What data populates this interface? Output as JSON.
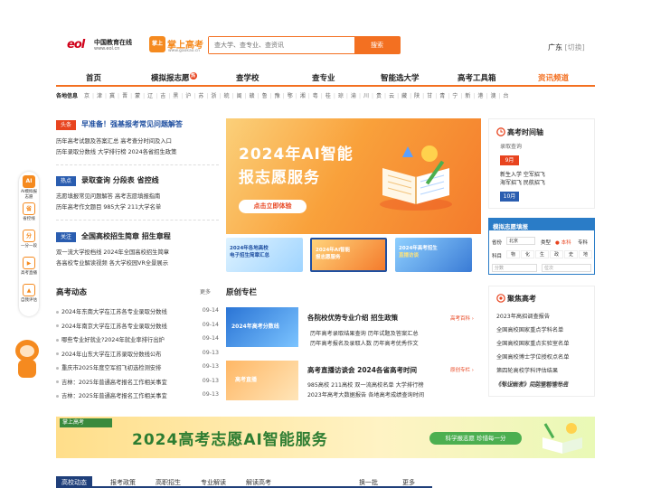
{
  "header": {
    "logo1_mark": "eol",
    "logo1_name": "中国教育在线",
    "logo1_url": "www.eol.cn",
    "logo2_icon": "掌上",
    "logo2_name": "掌上高考",
    "logo2_url": "www.gaokao.cn",
    "search_placeholder": "查大学、查专业、查资讯",
    "search_button": "搜索",
    "location": "广东",
    "switch": "[切换]"
  },
  "nav": {
    "items": [
      "首页",
      "模拟报志愿",
      "查学校",
      "查专业",
      "智能选大学",
      "高考工具箱",
      "资讯频道"
    ],
    "badge": "热"
  },
  "provinces": {
    "label": "各地信息",
    "list": [
      "京",
      "津",
      "冀",
      "晋",
      "蒙",
      "辽",
      "吉",
      "黑",
      "沪",
      "苏",
      "浙",
      "皖",
      "闽",
      "赣",
      "鲁",
      "豫",
      "鄂",
      "湘",
      "粤",
      "桂",
      "琼",
      "渝",
      "川",
      "贵",
      "云",
      "藏",
      "陕",
      "甘",
      "青",
      "宁",
      "新",
      "港",
      "澳",
      "台"
    ]
  },
  "float_bar": [
    {
      "icon": "AI",
      "label": "AI模拟报志愿"
    },
    {
      "icon": "省",
      "label": "省控线"
    },
    {
      "icon": "分",
      "label": "一分一段"
    },
    {
      "icon": "▶",
      "label": "高考直播"
    },
    {
      "icon": "▲",
      "label": "自我评估"
    }
  ],
  "headlines": [
    {
      "tag": "头条",
      "title": "早准备！强基报考常见问题解答",
      "subs": [
        "历年高考试题及答案汇总  高考查分时间及入口",
        "历年录取分数线  大学排行榜  2024各省招生政策"
      ]
    },
    {
      "tag": "热点",
      "title": "录取查询 分段表 省控线",
      "subs": [
        "志愿填报常见问题解答  高考志愿填报指南",
        "历年高考作文题目  985大学  211大学名单"
      ]
    },
    {
      "tag": "关注",
      "title": "全国高校招生简章 招生章程",
      "subs": [
        "双一流大学投档线  2024年全国高校招生简章",
        "各高校专业解读视频  各大学校园VR全景展示"
      ]
    }
  ],
  "banner": {
    "line1": "2024年AI智能",
    "line2": "报志愿服务",
    "cta": "点击立即体验"
  },
  "thumbs": [
    {
      "line1": "2024年各地高校",
      "line2": "电子招生简章汇总"
    },
    {
      "line1": "2024年AI智能",
      "line2": "报志愿服务"
    },
    {
      "line1": "2024年高考招生",
      "line2": "直播访谈"
    }
  ],
  "timeline": {
    "title": "高考时间轴",
    "sub": "录取查询",
    "month1": "9月",
    "items1": [
      "新生入学  空军招飞",
      "海军招飞  民航招飞"
    ],
    "month2": "10月"
  },
  "fill_form": {
    "title": "模拟志愿填报",
    "province_label": "省份",
    "province_value": "北京",
    "type_label": "类型",
    "type_a": "本科",
    "type_b": "专科",
    "subject_label": "科目",
    "subjects": [
      "物",
      "化",
      "生",
      "政",
      "史",
      "地"
    ],
    "score_placeholder": "分数",
    "rank_placeholder": "位次"
  },
  "focus": {
    "title": "聚焦高考",
    "items": [
      "2023年高招调查报告",
      "全国高校国家重点学科名单",
      "全国高校国家重点实验室名单",
      "全国高校博士学位授权点名单",
      "第四轮高校学科评估结果",
      "《数说高考》用数据解读高考",
      "《专业解读》从这里看懂专业"
    ]
  },
  "news": {
    "title": "高考动态",
    "more": "更多",
    "rows": [
      {
        "t": "2024年东南大学在江苏各专业录取分数线",
        "d": "09-14"
      },
      {
        "t": "2024年南京大学在江苏各专业录取分数线",
        "d": "09-14"
      },
      {
        "t": "哪些专业好就业?2024年就业率排行出炉",
        "d": "09-14"
      },
      {
        "t": "2024年山东大学在江苏录取分数线公布",
        "d": "09-13"
      },
      {
        "t": "重庆市2025年度空军招飞初选检测安排",
        "d": "09-13"
      },
      {
        "t": "吉林：2025年普通高考报名工作相关事宜",
        "d": "09-13"
      },
      {
        "t": "吉林：2025年普通高考报名工作相关事宜",
        "d": "09-13"
      }
    ]
  },
  "original": {
    "title": "原创专栏",
    "items": [
      {
        "img": "2024年高考分数线",
        "title": "各院校优势专业介绍 招生政策",
        "tag": "高考百科 ›",
        "lines": [
          "历年高考录取结果查询  历年试题及答案汇总",
          "历年高考报名及录取人数  历年高考优秀作文"
        ]
      },
      {
        "img": "高考直播",
        "title": "高考直播访谈会 2024各省高考时间",
        "tag": "原创专栏 ›",
        "lines": [
          "985高校  211高校  双一流高校名单  大学排行榜",
          "2023年高考大数据报告  各地高考成绩查询时间"
        ]
      }
    ]
  },
  "bottom_banner": {
    "logo": "掌上高考",
    "text": "2024高考志愿AI智能服务",
    "pill": "科学报志愿  珍惜每一分"
  },
  "tabs": {
    "items": [
      "高校动态",
      "报考政策",
      "高职招生",
      "专业解读",
      "解读高考"
    ],
    "refresh": "换一批",
    "more": "更多"
  }
}
